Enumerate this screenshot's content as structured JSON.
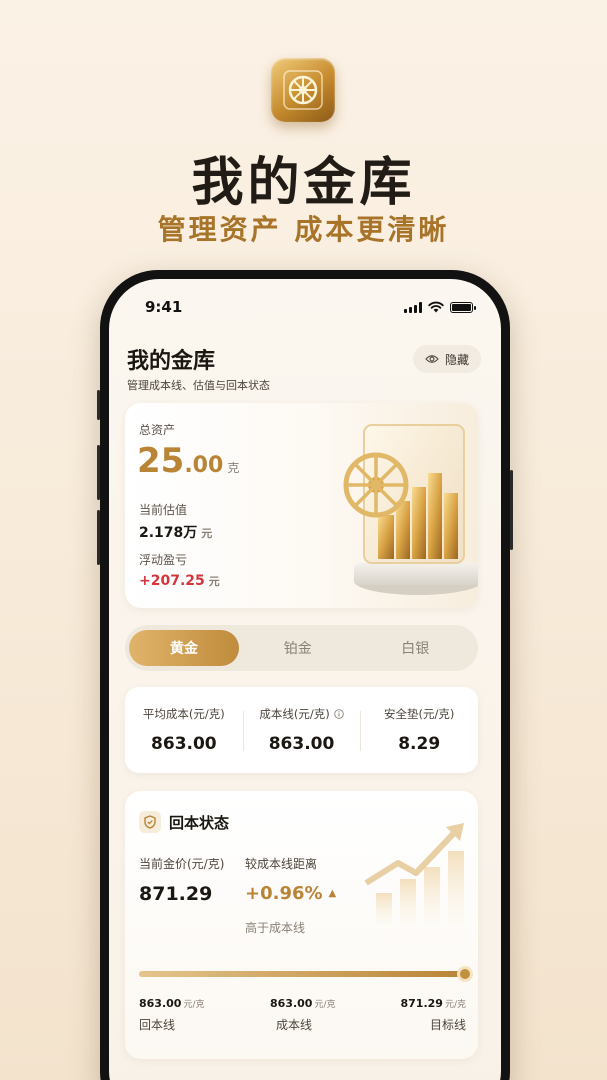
{
  "promo": {
    "title": "我的金库",
    "subtitle": "管理资产 成本更清晰"
  },
  "status_bar": {
    "time": "9:41"
  },
  "header": {
    "title": "我的金库",
    "subtitle": "管理成本线、估值与回本状态",
    "hide_label": "隐藏"
  },
  "assets": {
    "total_label": "总资产",
    "total_int": "25",
    "total_dec": ".00",
    "total_unit": "克",
    "estimate_label": "当前估值",
    "estimate_value": "2.178万",
    "estimate_unit": "元",
    "pnl_label": "浮动盈亏",
    "pnl_value": "+207.25",
    "pnl_unit": "元"
  },
  "metal_tabs": [
    {
      "label": "黄金",
      "active": true
    },
    {
      "label": "铂金",
      "active": false
    },
    {
      "label": "白银",
      "active": false
    }
  ],
  "cost": {
    "avg_label": "平均成本(元/克)",
    "avg_value": "863.00",
    "line_label": "成本线(元/克)",
    "line_value": "863.00",
    "cushion_label": "安全垫(元/克)",
    "cushion_value": "8.29"
  },
  "breakeven": {
    "title": "回本状态",
    "gold_price_label": "当前金价(元/克)",
    "gold_price_value": "871.29",
    "distance_label": "较成本线距离",
    "distance_value": "+0.96%",
    "distance_note": "高于成本线",
    "progress_fraction": 1.0,
    "ticks": [
      {
        "value": "863.00",
        "unit": "元/克",
        "name": "回本线"
      },
      {
        "value": "863.00",
        "unit": "元/克",
        "name": "成本线"
      },
      {
        "value": "871.29",
        "unit": "元/克",
        "name": "目标线"
      }
    ]
  },
  "colors": {
    "gold_accent": "#b98436",
    "loss_red": "#d4343a",
    "page_bg": "#fbf2e6"
  }
}
